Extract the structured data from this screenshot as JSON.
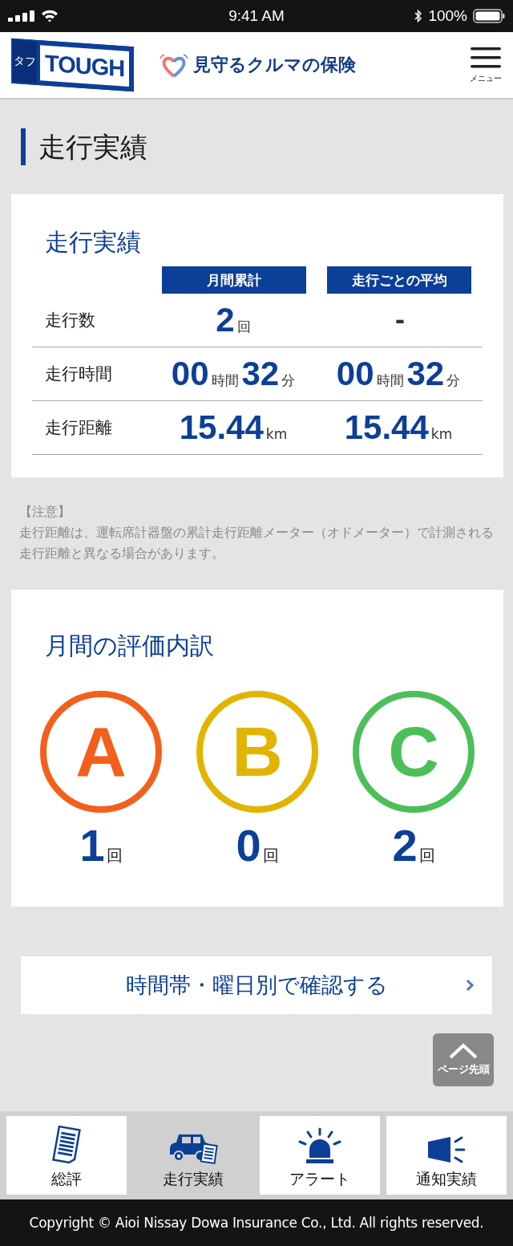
{
  "status_bar": {
    "time": "9:41 AM",
    "battery": "100%"
  },
  "header": {
    "logo_kana": "タフ",
    "logo": "TOUGH",
    "tagline": "見守るクルマの保険",
    "menu_label": "メニュー"
  },
  "page_title": "走行実績",
  "driving_card": {
    "title": "走行実績",
    "columns": [
      "月間累計",
      "走行ごとの平均"
    ],
    "rows": [
      {
        "label": "走行数",
        "cells": [
          [
            {
              "kind": "value",
              "text": "2"
            },
            {
              "kind": "unit",
              "text": "回"
            }
          ],
          [
            {
              "kind": "dash",
              "text": "-"
            }
          ]
        ]
      },
      {
        "label": "走行時間",
        "cells": [
          [
            {
              "kind": "value",
              "text": "00"
            },
            {
              "kind": "unit",
              "text": "時間"
            },
            {
              "kind": "value",
              "text": "32"
            },
            {
              "kind": "unit",
              "text": "分"
            }
          ],
          [
            {
              "kind": "value",
              "text": "00"
            },
            {
              "kind": "unit",
              "text": "時間"
            },
            {
              "kind": "value",
              "text": "32"
            },
            {
              "kind": "unit",
              "text": "分"
            }
          ]
        ]
      },
      {
        "label": "走行距離",
        "cells": [
          [
            {
              "kind": "value",
              "text": "15.44"
            },
            {
              "kind": "unit",
              "text": "km"
            }
          ],
          [
            {
              "kind": "value",
              "text": "15.44"
            },
            {
              "kind": "unit",
              "text": "km"
            }
          ]
        ]
      }
    ]
  },
  "note": {
    "heading": "【注意】",
    "text": "走行距離は、運転席計器盤の累計走行距離メーター（オドメーター）で計測される走行距離と異なる場合があります。"
  },
  "rating_card": {
    "title": "月間の評価内訳",
    "grades": [
      {
        "letter": "A",
        "count": "1",
        "unit": "回",
        "color": "#f2601c"
      },
      {
        "letter": "B",
        "count": "0",
        "unit": "回",
        "color": "#e2b400"
      },
      {
        "letter": "C",
        "count": "2",
        "unit": "回",
        "color": "#4cbf58"
      }
    ]
  },
  "link_button": "時間帯・曜日別で確認する",
  "page_top": "ページ先頭",
  "tabs": [
    {
      "label": "総評",
      "kind": "document",
      "selected": false
    },
    {
      "label": "走行実績",
      "kind": "car",
      "selected": true
    },
    {
      "label": "アラート",
      "kind": "beacon",
      "selected": false
    },
    {
      "label": "通知実績",
      "kind": "speaker",
      "selected": false
    }
  ],
  "footer": "Copyright © Aioi Nissay Dowa Insurance Co., Ltd. All rights reserved."
}
